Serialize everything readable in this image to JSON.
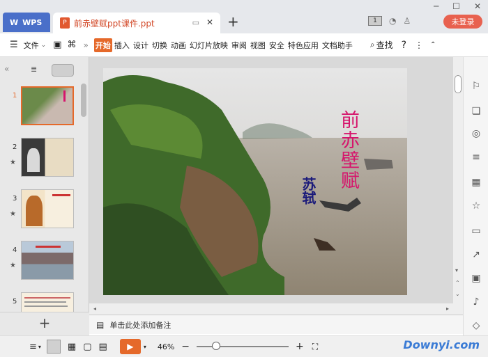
{
  "titlebar": {
    "wps_label": "WPS",
    "doc_tab": "前赤壁赋ppt课件.ppt",
    "doc_icon": "P",
    "new_tab": "+",
    "login_label": "未登录",
    "badge": "1"
  },
  "ribbon": {
    "file_label": "文件",
    "tabs": [
      "开始",
      "插入",
      "设计",
      "切换",
      "动画",
      "幻灯片放映",
      "审阅",
      "视图",
      "安全",
      "特色应用",
      "文档助手"
    ],
    "search_label": "查找",
    "help": "?"
  },
  "sidebar": {
    "slides": [
      {
        "num": "1",
        "star": ""
      },
      {
        "num": "2",
        "star": "★"
      },
      {
        "num": "3",
        "star": "★"
      },
      {
        "num": "4",
        "star": "★"
      },
      {
        "num": "5",
        "star": ""
      }
    ],
    "add_slide": "+"
  },
  "slide": {
    "title": "前赤壁赋",
    "author": "苏轼"
  },
  "notes": {
    "placeholder": "单击此处添加备注"
  },
  "statusbar": {
    "zoom": "46%",
    "watermark": "Downyi.com"
  },
  "colors": {
    "accent": "#e5692a",
    "wps_blue": "#4a6fc9",
    "title_magenta": "#d6156c",
    "author_navy": "#1a1a7a",
    "login_red": "#e8614f"
  }
}
